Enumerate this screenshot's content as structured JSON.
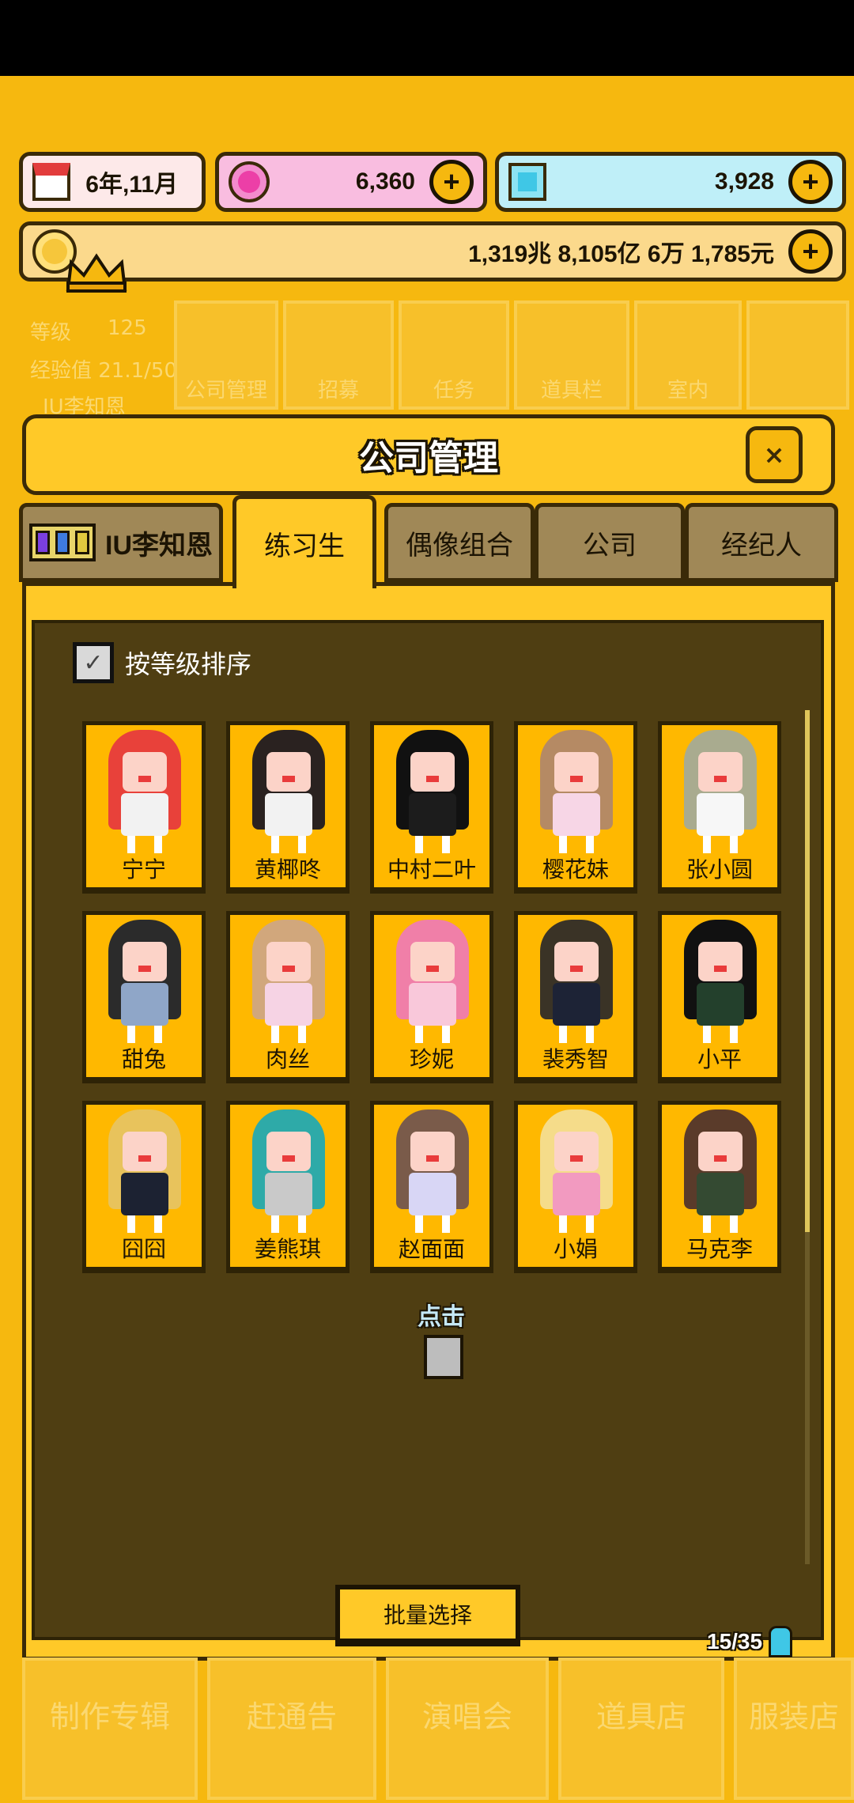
{
  "resources": {
    "date": "6年,11月",
    "pink_gems": "6,360",
    "blue_gems": "3,928",
    "money": "1,319兆 8,105亿 6万 1,785元"
  },
  "background_menu": {
    "level_label": "等级",
    "level_value": "125",
    "exp_label": "经验值 21.1/50",
    "profile_name": "IU李知恩",
    "items": [
      "公司管理",
      "招募",
      "任务",
      "道具栏",
      "室内"
    ]
  },
  "modal": {
    "title": "公司管理",
    "close_label": "×",
    "tabs": {
      "profile": "IU李知恩",
      "trainee": "练习生",
      "idol_group": "偶像组合",
      "company": "公司",
      "manager": "经纪人"
    },
    "sort_label": "按等级排序",
    "trainees": [
      {
        "name": "宁宁",
        "hair": "#e8413a",
        "outfit": "#f2f2f2"
      },
      {
        "name": "黄椰咚",
        "hair": "#2a2220",
        "outfit": "#f2f2f2"
      },
      {
        "name": "中村二叶",
        "hair": "#111111",
        "outfit": "#1c1c1c"
      },
      {
        "name": "樱花妹",
        "hair": "#b58a64",
        "outfit": "#f7d6e6"
      },
      {
        "name": "张小圆",
        "hair": "#a9ab8f",
        "outfit": "#f7f7f7"
      },
      {
        "name": "甜兔",
        "hair": "#2b2b2b",
        "outfit": "#8fa6c8"
      },
      {
        "name": "肉丝",
        "hair": "#d1a77c",
        "outfit": "#f6d3e4"
      },
      {
        "name": "珍妮",
        "hair": "#f07fa8",
        "outfit": "#f9c8da"
      },
      {
        "name": "裴秀智",
        "hair": "#3a3326",
        "outfit": "#1d2336"
      },
      {
        "name": "小平",
        "hair": "#111111",
        "outfit": "#23402c"
      },
      {
        "name": "囧囧",
        "hair": "#e8c35c",
        "outfit": "#1c2232"
      },
      {
        "name": "姜熊琪",
        "hair": "#2eaaa8",
        "outfit": "#c9c9c9"
      },
      {
        "name": "赵面面",
        "hair": "#7a5b4a",
        "outfit": "#d8d6f5"
      },
      {
        "name": "小娟",
        "hair": "#f5dc8a",
        "outfit": "#f29ac0"
      },
      {
        "name": "马克李",
        "hair": "#5a3b2a",
        "outfit": "#344a32"
      }
    ],
    "tap_hint": "点击",
    "batch_select": "批量选择",
    "count": "15/35"
  },
  "bottom_nav": [
    "制作专辑",
    "赶通告",
    "演唱会",
    "道具店",
    "服装店"
  ]
}
